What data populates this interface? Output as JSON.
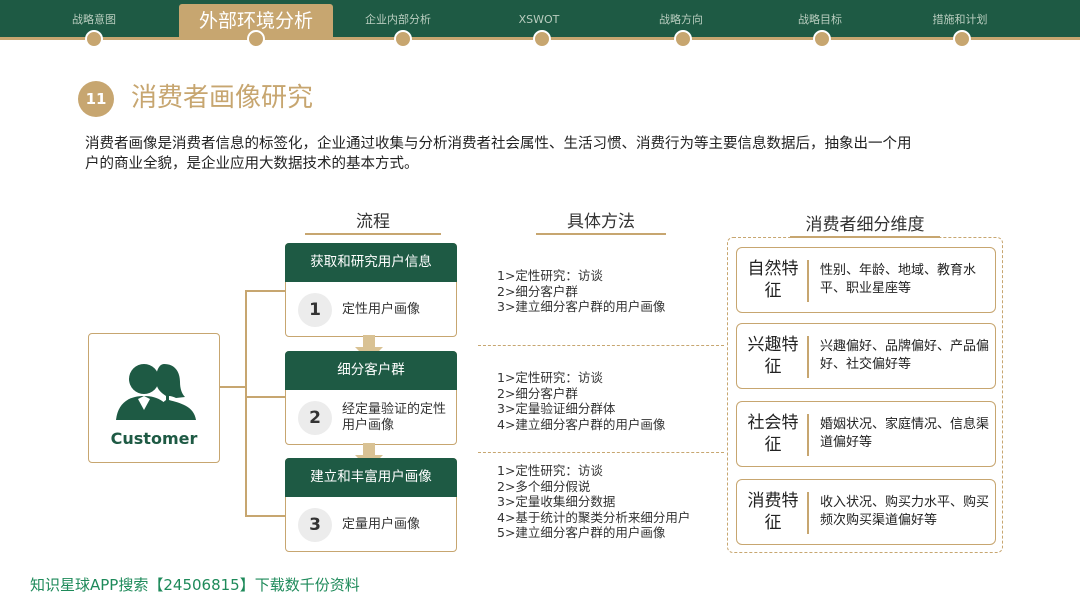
{
  "nav": {
    "items": [
      "战略意图",
      "外部环境分析",
      "企业内部分析",
      "XSWOT",
      "战略方向",
      "战略目标",
      "措施和计划"
    ],
    "active_label": "外部环境分析"
  },
  "section": {
    "number": "11",
    "title": "消费者画像研究",
    "intro": "消费者画像是消费者信息的标签化，企业通过收集与分析消费者社会属性、生活习惯、消费行为等主要信息数据后，抽象出一个用户的商业全貌，是企业应用大数据技术的基本方式。"
  },
  "columns": {
    "flow": "流程",
    "methods": "具体方法",
    "dimensions": "消费者细分维度"
  },
  "customer": {
    "label": "Customer",
    "icon": "users-icon"
  },
  "flow": [
    {
      "header": "获取和研究用户信息",
      "num": "1",
      "text": "定性用户画像"
    },
    {
      "header": "细分客户群",
      "num": "2",
      "text": "经定量验证的定性用户画像"
    },
    {
      "header": "建立和丰富用户画像",
      "num": "3",
      "text": "定量用户画像"
    }
  ],
  "methods": [
    [
      "1>定性研究：访谈",
      "2>细分客户群",
      "3>建立细分客户群的用户画像"
    ],
    [
      "1>定性研究：访谈",
      "2>细分客户群",
      "3>定量验证细分群体",
      "4>建立细分客户群的用户画像"
    ],
    [
      "1>定性研究：访谈",
      "2>多个细分假说",
      "3>定量收集细分数据",
      "4>基于统计的聚类分析来细分用户",
      "5>建立细分客户群的用户画像"
    ]
  ],
  "dimensions": [
    {
      "label": "自然特征",
      "text": "性别、年龄、地域、教育水平、职业星座等"
    },
    {
      "label": "兴趣特征",
      "text": "兴趣偏好、品牌偏好、产品偏好、社交偏好等"
    },
    {
      "label": "社会特征",
      "text": "婚姻状况、家庭情况、信息渠道偏好等"
    },
    {
      "label": "消费特征",
      "text": "收入状况、购买力水平、购买频次购买渠道偏好等"
    }
  ],
  "footer": "知识星球APP搜索【24506815】下载数千份资料",
  "colors": {
    "green": "#1e5a44",
    "gold": "#c7a670",
    "footer": "#1e8a5a"
  }
}
